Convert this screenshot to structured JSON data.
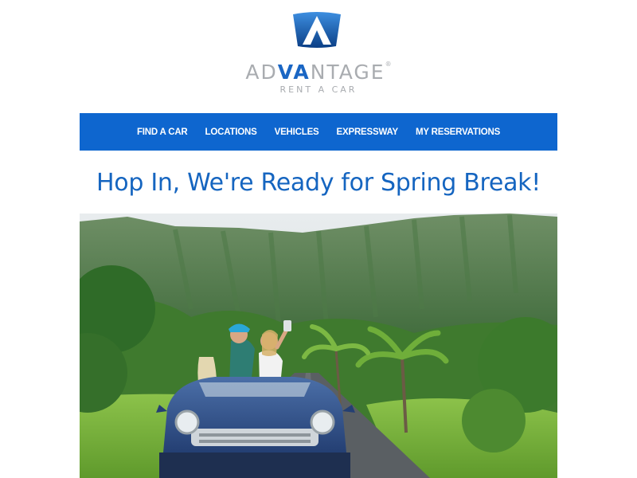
{
  "brand": {
    "name_prefix": "AD",
    "name_accent": "VA",
    "name_suffix": "NTAGE",
    "trademark": "®",
    "subtitle": "RENT A CAR",
    "logo_icon": "advantage-shield-icon",
    "colors": {
      "primary": "#0e66cf",
      "gray": "#a9acb0"
    }
  },
  "nav": {
    "items": [
      {
        "label": "FIND A CAR"
      },
      {
        "label": "LOCATIONS"
      },
      {
        "label": "VEHICLES"
      },
      {
        "label": "EXPRESSWAY"
      },
      {
        "label": "MY RESERVATIONS"
      }
    ]
  },
  "headline": "Hop In, We're Ready for Spring Break!",
  "hero": {
    "image": "women-taking-selfie-in-blue-convertible-on-tropical-mountain-road"
  }
}
